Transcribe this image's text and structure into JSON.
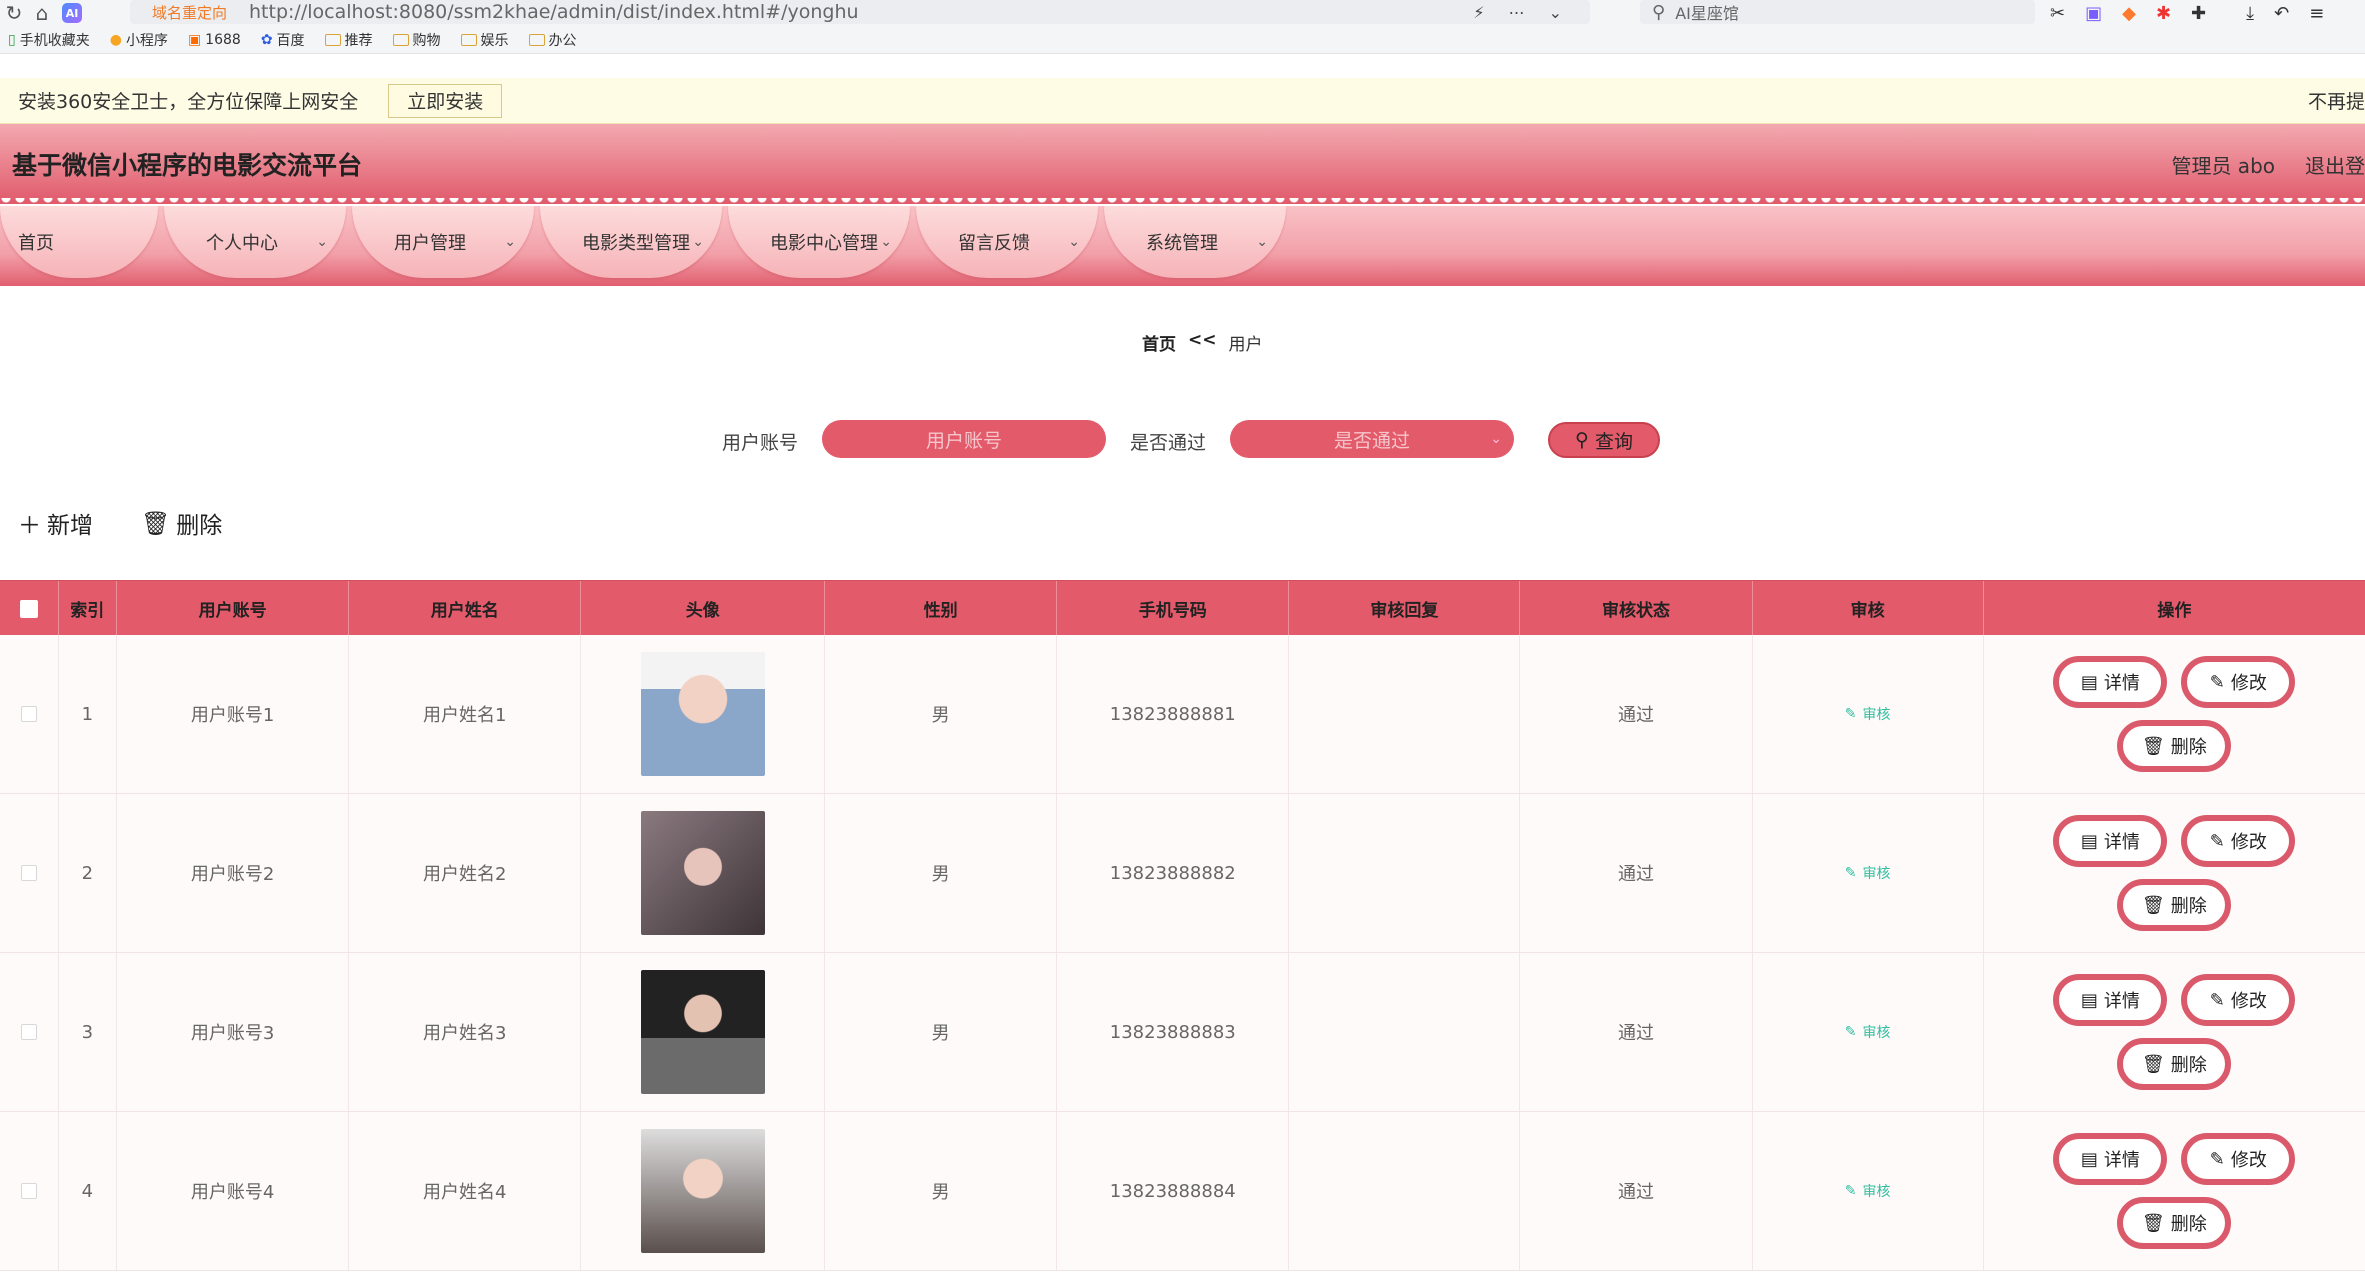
{
  "browser": {
    "redirect_tag": "域名重定向",
    "url": "http://localhost:8080/ssm2khae/admin/dist/index.html#/yonghu",
    "search_placeholder": "AI星座馆"
  },
  "bookmarks": [
    {
      "label": "手机收藏夹",
      "icon": "phone-bookmark-icon"
    },
    {
      "label": "小程序",
      "icon": "miniapp-icon"
    },
    {
      "label": "1688",
      "icon": "1688-icon"
    },
    {
      "label": "百度",
      "icon": "baidu-icon"
    },
    {
      "label": "推荐",
      "icon": "folder-icon"
    },
    {
      "label": "购物",
      "icon": "folder-icon"
    },
    {
      "label": "娱乐",
      "icon": "folder-icon"
    },
    {
      "label": "办公",
      "icon": "folder-icon"
    }
  ],
  "notice": {
    "text": "安装360安全卫士，全方位保障上网安全",
    "install": "立即安装",
    "dismiss": "不再提"
  },
  "header": {
    "title": "基于微信小程序的电影交流平台",
    "admin": "管理员 abo",
    "logout": "退出登"
  },
  "menu": [
    {
      "label": "首页"
    },
    {
      "label": "个人中心"
    },
    {
      "label": "用户管理"
    },
    {
      "label": "电影类型管理"
    },
    {
      "label": "电影中心管理"
    },
    {
      "label": "留言反馈"
    },
    {
      "label": "系统管理"
    }
  ],
  "breadcrumb": {
    "home": "首页",
    "sep": "<<",
    "current": "用户"
  },
  "search": {
    "account_label": "用户账号",
    "account_placeholder": "用户账号",
    "pass_label": "是否通过",
    "pass_placeholder": "是否通过",
    "query": "查询"
  },
  "toolbar": {
    "add": "新增",
    "delete": "删除"
  },
  "table": {
    "headers": [
      "索引",
      "用户账号",
      "用户姓名",
      "头像",
      "性别",
      "手机号码",
      "审核回复",
      "审核状态",
      "审核",
      "操作"
    ],
    "rows": [
      {
        "index": "1",
        "account": "用户账号1",
        "name": "用户姓名1",
        "gender": "男",
        "phone": "13823888881",
        "reply": "",
        "status": "通过",
        "audit": "审核"
      },
      {
        "index": "2",
        "account": "用户账号2",
        "name": "用户姓名2",
        "gender": "男",
        "phone": "13823888882",
        "reply": "",
        "status": "通过",
        "audit": "审核"
      },
      {
        "index": "3",
        "account": "用户账号3",
        "name": "用户姓名3",
        "gender": "男",
        "phone": "13823888883",
        "reply": "",
        "status": "通过",
        "audit": "审核"
      },
      {
        "index": "4",
        "account": "用户账号4",
        "name": "用户姓名4",
        "gender": "男",
        "phone": "13823888884",
        "reply": "",
        "status": "通过",
        "audit": "审核"
      }
    ],
    "ops": {
      "detail": "详情",
      "edit": "修改",
      "delete": "删除"
    }
  },
  "colors": {
    "accent": "#e35a6a",
    "audit": "#2fbf9f"
  }
}
